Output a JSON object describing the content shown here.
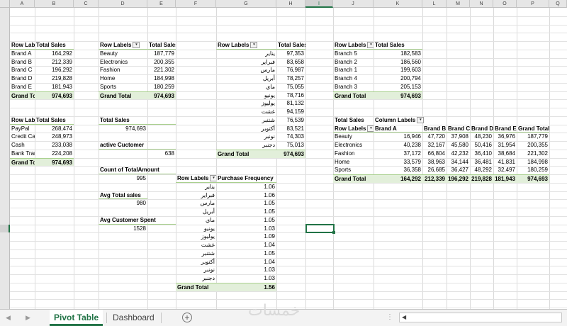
{
  "columns": [
    "A",
    "B",
    "C",
    "D",
    "E",
    "F",
    "G",
    "H",
    "I",
    "J",
    "K",
    "L",
    "M",
    "N",
    "O",
    "P",
    "Q"
  ],
  "selected_column": "I",
  "pivot_brand": {
    "row_header": "Row Labels",
    "val_header": "Total Sales",
    "rows": [
      [
        "Brand A",
        "164,292"
      ],
      [
        "Brand B",
        "212,339"
      ],
      [
        "Brand C",
        "196,292"
      ],
      [
        "Brand D",
        "219,828"
      ],
      [
        "Brand E",
        "181,943"
      ]
    ],
    "total_label": "Grand Total",
    "total": "974,693"
  },
  "pivot_category": {
    "row_header": "Row Labels",
    "val_header": "Total Sales",
    "rows": [
      [
        "Beauty",
        "187,779"
      ],
      [
        "Electronics",
        "200,355"
      ],
      [
        "Fashion",
        "221,302"
      ],
      [
        "Home",
        "184,998"
      ],
      [
        "Sports",
        "180,259"
      ]
    ],
    "total_label": "Grand Total",
    "total": "974,693"
  },
  "pivot_month_sales": {
    "row_header": "Row Labels",
    "val_header": "Total Sales",
    "rows": [
      [
        "يناير",
        "97,353"
      ],
      [
        "فبراير",
        "83,658"
      ],
      [
        "مارس",
        "76,987"
      ],
      [
        "أبريل",
        "78,257"
      ],
      [
        "ماي",
        "75,055"
      ],
      [
        "يونيو",
        "78,716"
      ],
      [
        "يوليوز",
        "81,132"
      ],
      [
        "غشت",
        "94,159"
      ],
      [
        "شتنبر",
        "76,539"
      ],
      [
        "أكتوبر",
        "83,521"
      ],
      [
        "نونبر",
        "74,303"
      ],
      [
        "دجنبر",
        "75,013"
      ]
    ],
    "total_label": "Grand Total",
    "total": "974,693"
  },
  "pivot_branch": {
    "row_header": "Row Labels",
    "val_header": "Total Sales",
    "rows": [
      [
        "Branch 5",
        "182,583"
      ],
      [
        "Branch 2",
        "186,560"
      ],
      [
        "Branch 1",
        "199,603"
      ],
      [
        "Branch 4",
        "200,794"
      ],
      [
        "Branch 3",
        "205,153"
      ]
    ],
    "total_label": "Grand Total",
    "total": "974,693"
  },
  "pivot_payment": {
    "row_header": "Row Labels",
    "val_header": "Total Sales",
    "rows": [
      [
        "PayPal",
        "268,474"
      ],
      [
        "Credit Card",
        "248,973"
      ],
      [
        "Cash",
        "233,038"
      ],
      [
        "Bank Transfer",
        "224,208"
      ]
    ],
    "total_label": "Grand Total",
    "total": "974,693"
  },
  "kpis": {
    "total_sales_label": "Total Sales",
    "total_sales_value": "974,693",
    "active_customer_label": "active Cuctomer",
    "active_customer_value": "638",
    "count_label": "Count of TotalAmount",
    "count_value": "995",
    "avg_sales_label": "Avg Total sales",
    "avg_sales_value": "980",
    "avg_spent_label": "Avg Customer Spent",
    "avg_spent_value": "1528"
  },
  "pivot_frequency": {
    "row_header": "Row Labels",
    "val_header": "Purchase Frequency",
    "rows": [
      [
        "يناير",
        "1.06"
      ],
      [
        "فبراير",
        "1.06"
      ],
      [
        "مارس",
        "1.05"
      ],
      [
        "أبريل",
        "1.05"
      ],
      [
        "ماي",
        "1.05"
      ],
      [
        "يونيو",
        "1.03"
      ],
      [
        "يوليوز",
        "1.09"
      ],
      [
        "غشت",
        "1.04"
      ],
      [
        "شتنبر",
        "1.05"
      ],
      [
        "أكتوبر",
        "1.04"
      ],
      [
        "نونبر",
        "1.03"
      ],
      [
        "دجنبر",
        "1.03"
      ]
    ],
    "total_label": "Grand Total",
    "total": "1.56"
  },
  "matrix": {
    "corner_label": "Total Sales",
    "col_labels_header": "Column Labels",
    "row_header": "Row Labels",
    "brands": [
      "Brand A",
      "Brand B",
      "Brand C",
      "Brand D",
      "Brand E",
      "Grand Total"
    ],
    "rows": [
      [
        "Beauty",
        "16,946",
        "47,720",
        "37,908",
        "48,230",
        "36,976",
        "187,779"
      ],
      [
        "Electronics",
        "40,238",
        "32,167",
        "45,580",
        "50,416",
        "31,954",
        "200,355"
      ],
      [
        "Fashion",
        "37,172",
        "66,804",
        "42,232",
        "36,410",
        "38,684",
        "221,302"
      ],
      [
        "Home",
        "33,579",
        "38,963",
        "34,144",
        "36,481",
        "41,831",
        "184,998"
      ],
      [
        "Sports",
        "36,358",
        "26,685",
        "36,427",
        "48,292",
        "32,497",
        "180,259"
      ]
    ],
    "total": [
      "Grand Total",
      "164,292",
      "212,339",
      "196,292",
      "219,828",
      "181,943",
      "974,693"
    ]
  },
  "tabs": {
    "active": "Pivot Table",
    "other": "Dashboard",
    "add": "+"
  },
  "watermark": "خمسات",
  "icons": {
    "prev": "◀",
    "next": "▶",
    "scroll_left": "◀",
    "more": "⋮"
  }
}
